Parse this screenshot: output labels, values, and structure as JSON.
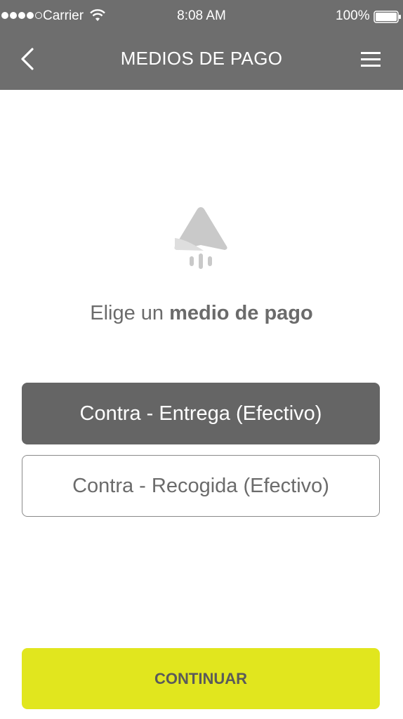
{
  "status_bar": {
    "carrier": "Carrier",
    "time": "8:08 AM",
    "battery": "100%"
  },
  "header": {
    "title": "MEDIOS DE PAGO",
    "back_icon": "chevron-left-icon",
    "menu_icon": "hamburger-menu-icon"
  },
  "main": {
    "logo_icon": "rocket-logo-icon",
    "prompt_prefix": "Elige un ",
    "prompt_bold": "medio de pago",
    "options": [
      {
        "label": "Contra - Entrega (Efectivo)",
        "selected": true
      },
      {
        "label": "Contra - Recogida (Efectivo)",
        "selected": false
      }
    ]
  },
  "footer": {
    "continue_label": "CONTINUAR"
  },
  "colors": {
    "header_bg": "#6e6e6e",
    "selected_bg": "#656565",
    "accent": "#e1e61e"
  }
}
